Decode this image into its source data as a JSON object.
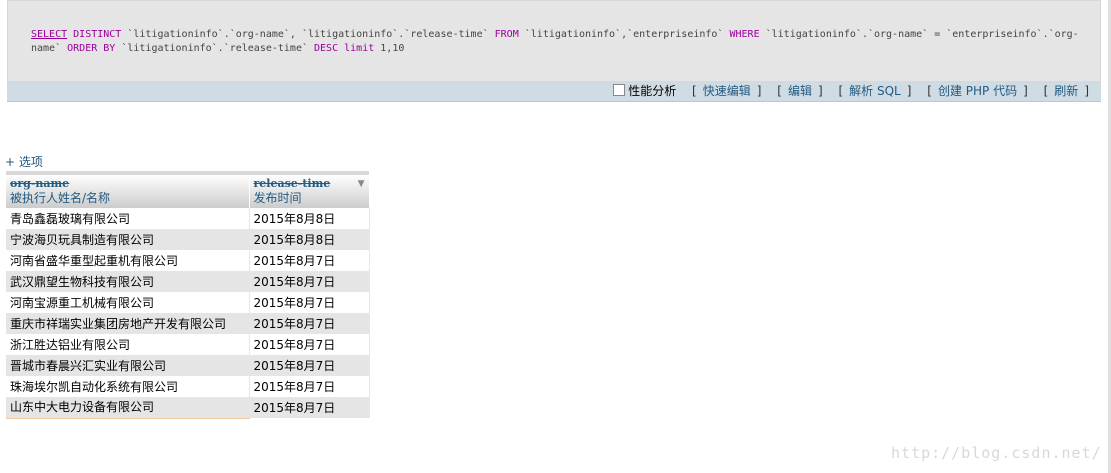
{
  "sql": {
    "tokens": [
      {
        "t": "SELECT",
        "c": "kw-u"
      },
      {
        "t": " "
      },
      {
        "t": "DISTINCT",
        "c": "kw"
      },
      {
        "t": " "
      },
      {
        "t": "`litigationinfo`.`org-name`",
        "c": "id"
      },
      {
        "t": ", "
      },
      {
        "t": "`litigationinfo`.`release-time`",
        "c": "id"
      },
      {
        "t": " "
      },
      {
        "t": "FROM",
        "c": "kw"
      },
      {
        "t": " "
      },
      {
        "t": "`litigationinfo`",
        "c": "id"
      },
      {
        "t": ","
      },
      {
        "t": "`enterpriseinfo`",
        "c": "id"
      },
      {
        "t": " "
      },
      {
        "t": "WHERE",
        "c": "kw"
      },
      {
        "t": " "
      },
      {
        "t": "`litigationinfo`.`org-name`",
        "c": "id"
      },
      {
        "t": " = "
      },
      {
        "t": "`enterpriseinfo`.`org-name`",
        "c": "id"
      },
      {
        "t": " "
      },
      {
        "t": "ORDER BY",
        "c": "kw"
      },
      {
        "t": " "
      },
      {
        "t": "`litigationinfo`.`release-time`",
        "c": "id"
      },
      {
        "t": " "
      },
      {
        "t": "DESC",
        "c": "kw"
      },
      {
        "t": " "
      },
      {
        "t": "limit",
        "c": "kw"
      },
      {
        "t": " "
      },
      {
        "t": "1,10",
        "c": "num"
      }
    ]
  },
  "toolbar": {
    "profiling_label": "性能分析",
    "inline_edit": "快速编辑",
    "edit": "编辑",
    "explain": "解析 SQL",
    "create_php": "创建 PHP 代码",
    "refresh": "刷新",
    "bracket_open": "[",
    "bracket_close": "]"
  },
  "options": {
    "label": "+ 选项"
  },
  "table": {
    "columns": [
      {
        "name": "org-name",
        "comment": "被执行人姓名/名称"
      },
      {
        "name": "release-time",
        "comment": "发布时间",
        "sort_icon": "sort-desc-icon"
      }
    ],
    "rows": [
      [
        "青岛鑫磊玻璃有限公司",
        "2015年8月8日"
      ],
      [
        "宁波海贝玩具制造有限公司",
        "2015年8月8日"
      ],
      [
        "河南省盛华重型起重机有限公司",
        "2015年8月7日"
      ],
      [
        "武汉鼎望生物科技有限公司",
        "2015年8月7日"
      ],
      [
        "河南宝源重工机械有限公司",
        "2015年8月7日"
      ],
      [
        "重庆市祥瑞实业集团房地产开发有限公司",
        "2015年8月7日"
      ],
      [
        "浙江胜达铝业有限公司",
        "2015年8月7日"
      ],
      [
        "晋城市春晨兴汇实业有限公司",
        "2015年8月7日"
      ],
      [
        "珠海埃尔凯自动化系统有限公司",
        "2015年8月7日"
      ],
      [
        "山东中大电力设备有限公司",
        "2015年8月7日"
      ]
    ]
  },
  "watermark": {
    "text": "http://blog.csdn.net/"
  }
}
